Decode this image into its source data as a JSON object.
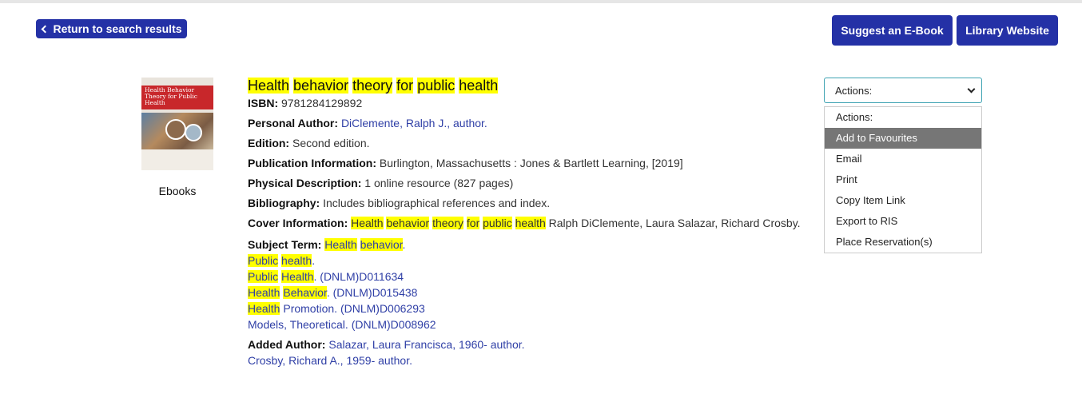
{
  "nav": {
    "return_label": "Return to search results",
    "suggest_label": "Suggest an E-Book",
    "library_label": "Library Website"
  },
  "cover": {
    "title_text": "Health Behavior Theory for Public Health",
    "format": "Ebooks"
  },
  "record": {
    "title_words": [
      "Health",
      "behavior",
      "theory",
      "for",
      "public",
      "health"
    ],
    "isbn_label": "ISBN:",
    "isbn": "9781284129892",
    "author_label": "Personal Author:",
    "author": "DiClemente, Ralph J., author.",
    "edition_label": "Edition:",
    "edition": "Second edition.",
    "pub_label": "Publication Information:",
    "pub": "Burlington, Massachusetts : Jones & Bartlett Learning, [2019]",
    "phys_label": "Physical Description:",
    "phys": "1 online resource (827 pages)",
    "biblio_label": "Bibliography:",
    "biblio": "Includes bibliographical references and index.",
    "cover_label": "Cover Information:",
    "cover_words": [
      "Health",
      "behavior",
      "theory",
      "for",
      "public",
      "health"
    ],
    "cover_rest": "Ralph DiClemente, Laura Salazar, Richard Crosby.",
    "subject_label": "Subject Term:",
    "subjects": [
      {
        "hl": [
          "Health",
          "behavior"
        ],
        "rest": "."
      },
      {
        "hl": [
          "Public",
          "health"
        ],
        "rest": "."
      },
      {
        "hl": [
          "Public",
          "Health"
        ],
        "rest": ". (DNLM)D011634"
      },
      {
        "hl": [
          "Health",
          "Behavior"
        ],
        "rest": ". (DNLM)D015438"
      },
      {
        "hl": [
          "Health"
        ],
        "rest": " Promotion. (DNLM)D006293"
      },
      {
        "hl": [],
        "rest": "Models, Theoretical. (DNLM)D008962"
      }
    ],
    "added_label": "Added Author:",
    "added_authors": [
      "Salazar, Laura Francisca, 1960- author.",
      "Crosby, Richard A., 1959- author."
    ]
  },
  "actions": {
    "selected": "Actions:",
    "options": [
      "Actions:",
      "Add to Favourites",
      "Email",
      "Print",
      "Copy Item Link",
      "Export to RIS",
      "Place Reservation(s)"
    ],
    "highlighted_index": 1
  },
  "colors": {
    "button_bg": "#2431a6",
    "highlight": "#ffff00",
    "link": "#2f3fa6"
  }
}
